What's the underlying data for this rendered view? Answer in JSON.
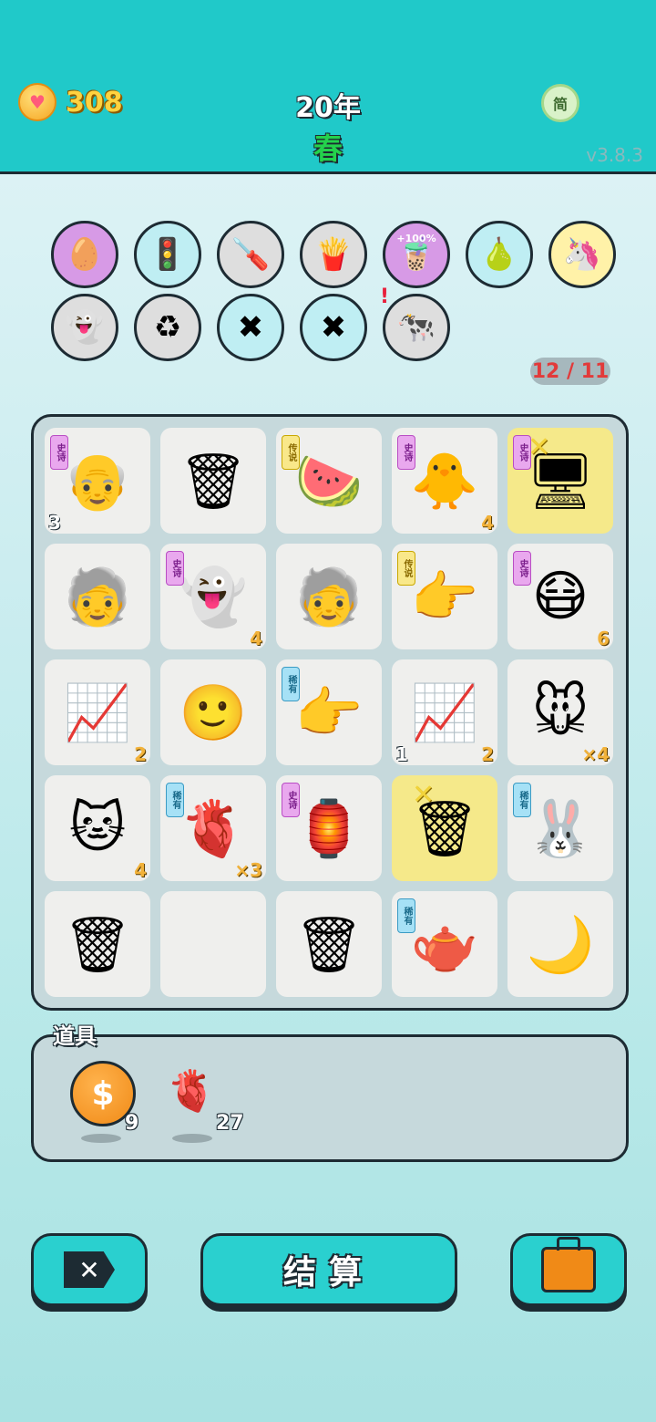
{
  "header": {
    "coins": "308",
    "year": "20年",
    "season": "春",
    "lang_button": "简",
    "version": "v3.8.3"
  },
  "passives": [
    {
      "name": "egg-head-icon",
      "glyph": "🥚",
      "bg": "#d79ae6"
    },
    {
      "name": "traffic-light-ghost-icon",
      "glyph": "🚦",
      "bg": "#bfeef3"
    },
    {
      "name": "screwdriver-icon",
      "glyph": "🪛",
      "bg": "#dedede"
    },
    {
      "name": "fries-icon",
      "glyph": "🍟",
      "bg": "#dedede"
    },
    {
      "name": "bucket-icon",
      "glyph": "🧋",
      "bg": "#d79ae6",
      "tag": "+100%"
    },
    {
      "name": "pomelo-icon",
      "glyph": "🍐",
      "bg": "#bfeef3"
    },
    {
      "name": "unicorn-icon",
      "glyph": "🦄",
      "bg": "#fff2a8"
    },
    {
      "name": "ghost-icon",
      "glyph": "👻",
      "bg": "#dedede"
    },
    {
      "name": "recycle-bag-icon",
      "glyph": "♻",
      "bg": "#dedede"
    },
    {
      "name": "tape-x-icon",
      "glyph": "✖",
      "bg": "#bfeef3"
    },
    {
      "name": "tape-x-icon",
      "glyph": "✖",
      "bg": "#bfeef3"
    },
    {
      "name": "cow-pair-icon",
      "glyph": "🐄",
      "bg": "#dedede"
    }
  ],
  "counter": "12 / 11",
  "grid": [
    {
      "name": "old-man-icon",
      "glyph": "👴",
      "badge": "史诗",
      "badge_type": "epic",
      "num_bl": "3"
    },
    {
      "name": "trash-bag-icon",
      "glyph": "🗑"
    },
    {
      "name": "watermelon-icon",
      "glyph": "🍉",
      "badge": "传说",
      "badge_type": "legend"
    },
    {
      "name": "yellow-chick-face-icon",
      "glyph": "🐥",
      "badge": "史诗",
      "badge_type": "epic",
      "num_br": "4"
    },
    {
      "name": "graphics-card-icon",
      "glyph": "🖥",
      "badge": "史诗",
      "badge_type": "epic",
      "hl": true
    },
    {
      "name": "balding-man-icon",
      "glyph": "🧓"
    },
    {
      "name": "dead-ghost-icon",
      "glyph": "👻",
      "badge": "史诗",
      "badge_type": "epic",
      "num_br": "4"
    },
    {
      "name": "balding-man-icon",
      "glyph": "🧓"
    },
    {
      "name": "golden-finger-icon",
      "glyph": "👉",
      "badge": "传说",
      "badge_type": "legend"
    },
    {
      "name": "masked-man-icon",
      "glyph": "😷",
      "badge": "史诗",
      "badge_type": "epic",
      "num_br": "6"
    },
    {
      "name": "stock-chart-icon",
      "glyph": "📈",
      "num_br": "2"
    },
    {
      "name": "man-face-icon",
      "glyph": "🙂"
    },
    {
      "name": "brown-finger-icon",
      "glyph": "👉",
      "badge": "稀有",
      "badge_type": "rare"
    },
    {
      "name": "growth-card-icon",
      "glyph": "📈",
      "num_bl": "1",
      "num_br": "2"
    },
    {
      "name": "mouse-icon",
      "glyph": "🐭",
      "num_br": "×4"
    },
    {
      "name": "cat-icon",
      "glyph": "🐱",
      "num_br": "4"
    },
    {
      "name": "sacrificed-liver-icon",
      "glyph": "🫀",
      "badge": "稀有",
      "badge_type": "rare",
      "num_br": "×3"
    },
    {
      "name": "rabbit-house-icon",
      "glyph": "🏮",
      "badge": "史诗",
      "badge_type": "epic"
    },
    {
      "name": "big-trash-bag-icon",
      "glyph": "🗑",
      "hl": true
    },
    {
      "name": "bunny-icon",
      "glyph": "🐰",
      "badge": "稀有",
      "badge_type": "rare"
    },
    {
      "name": "trash-bag-icon",
      "glyph": "🗑"
    },
    {
      "name": "empty-cell",
      "glyph": ""
    },
    {
      "name": "trash-bag-icon",
      "glyph": "🗑"
    },
    {
      "name": "teapot-icon",
      "glyph": "🫖",
      "badge": "稀有",
      "badge_type": "rare"
    },
    {
      "name": "moon-icon",
      "glyph": "🌙"
    }
  ],
  "props": {
    "title": "道具",
    "items": [
      {
        "name": "dollar-coin-icon",
        "glyph": "$",
        "qty": "9"
      },
      {
        "name": "liver-icon",
        "glyph": "🫀",
        "qty": "27"
      }
    ]
  },
  "buttons": {
    "close_glyph": "✕",
    "settle": "结算"
  }
}
